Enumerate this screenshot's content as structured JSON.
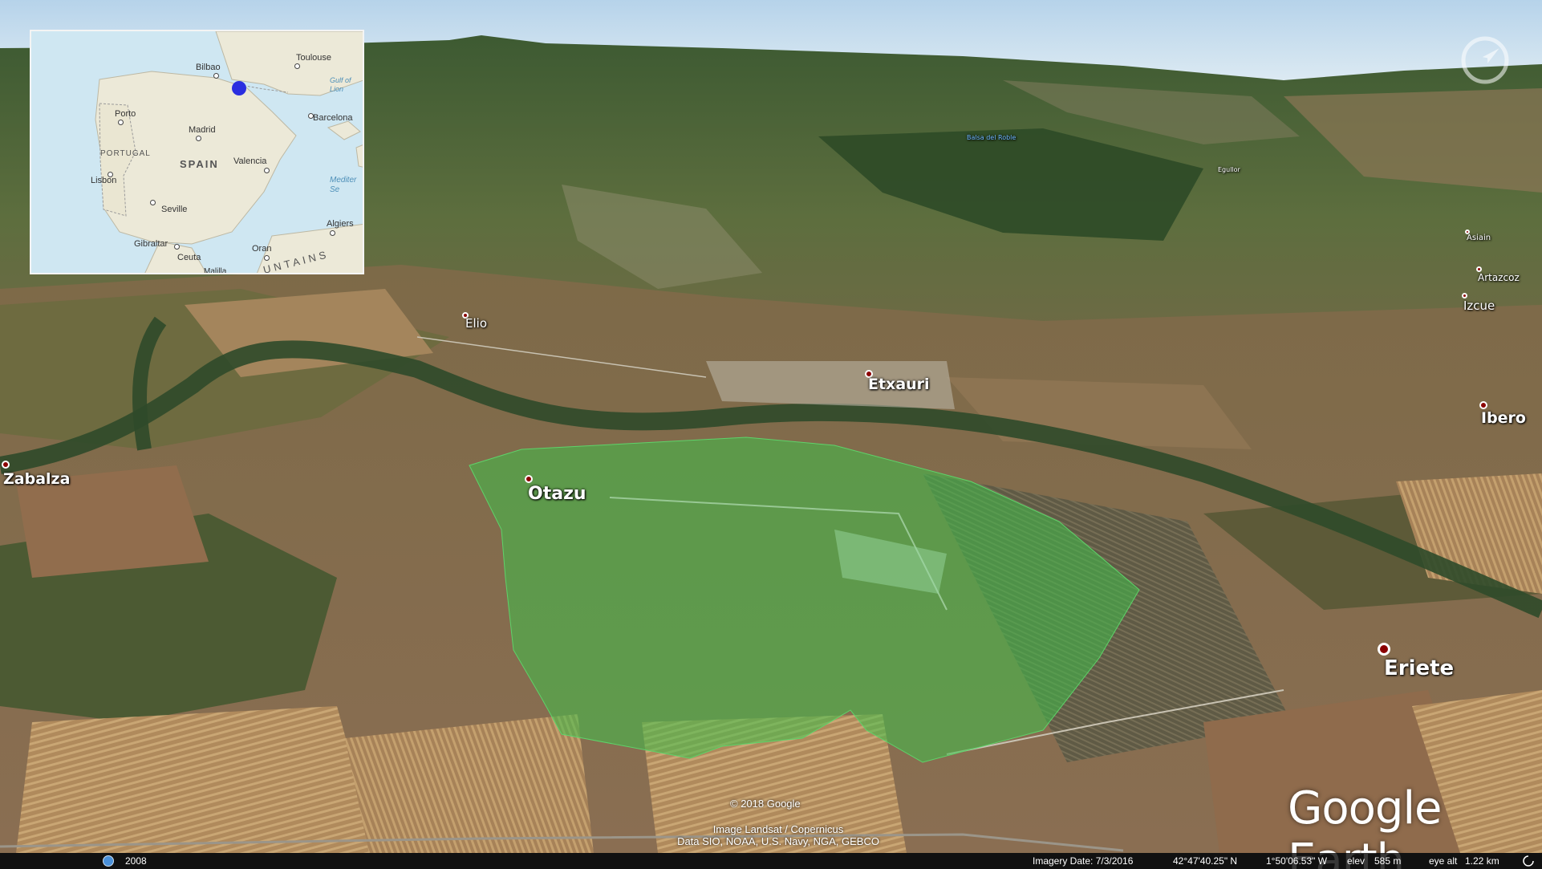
{
  "app": {
    "brand": "Google Earth"
  },
  "inset_map": {
    "cities": [
      {
        "name": "Toulouse"
      },
      {
        "name": "Bilbao"
      },
      {
        "name": "Porto"
      },
      {
        "name": "Madrid"
      },
      {
        "name": "Barcelona"
      },
      {
        "name": "Valencia"
      },
      {
        "name": "Lisbon"
      },
      {
        "name": "Seville"
      },
      {
        "name": "Gibraltar"
      },
      {
        "name": "Algiers"
      },
      {
        "name": "Oran"
      },
      {
        "name": "Ceuta"
      },
      {
        "name": "Malilla"
      }
    ],
    "countries": {
      "portugal": "PORTUGAL",
      "spain": "SPAIN"
    },
    "seas": {
      "gulf": "Gulf of\nLion",
      "med": "Mediter\nSe"
    },
    "mountains": "UNTAINS",
    "marker_color": "#2a2ee0"
  },
  "places": {
    "otazu": "Otazu",
    "etxauri": "Etxauri",
    "eriete": "Eriete",
    "zabalza": "Zabalza",
    "elio": "Elio",
    "ibero": "Ibero",
    "izcue": "Izcue",
    "artazcoz": "Artazcoz",
    "asiain": "Asiain",
    "egullor": "Egullor",
    "balsa": "Balsa del Roble"
  },
  "overlay": {
    "color": "#3fbf4a",
    "opacity": 0.55
  },
  "attribution": {
    "copyright": "© 2018 Google",
    "line1": "Image Landsat / Copernicus",
    "line2": "Data SIO, NOAA, U.S. Navy, NGA, GEBCO"
  },
  "status": {
    "year": "2008",
    "imagery_date": "Imagery Date: 7/3/2016",
    "lat": "42°47'40.25\" N",
    "lon": "1°50'06.53\" W",
    "elev_label": "elev",
    "elev": "585 m",
    "eye_label": "eye alt",
    "eye_alt": "1.22 km"
  }
}
